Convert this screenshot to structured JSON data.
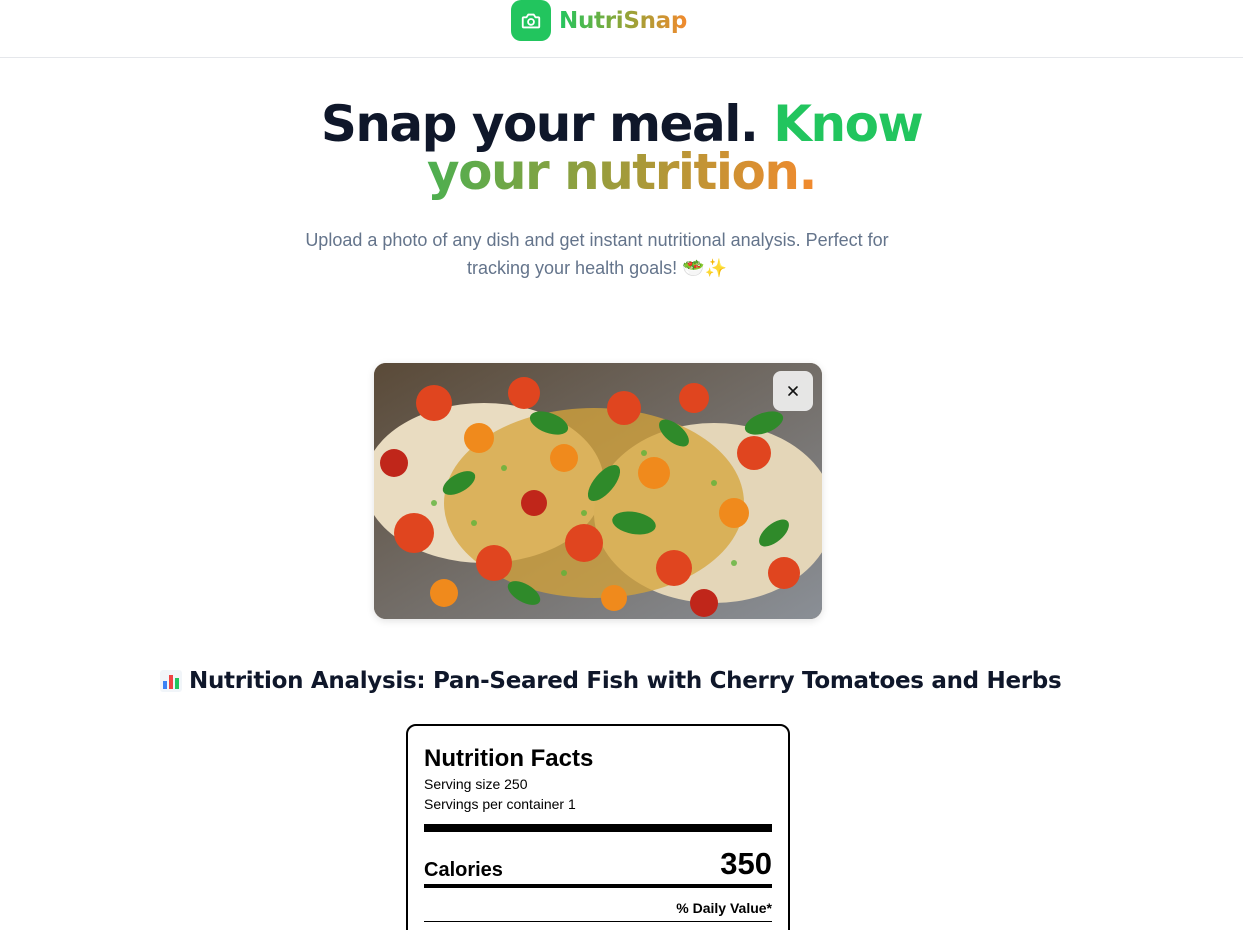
{
  "brand": {
    "name": "NutriSnap",
    "icon": "camera-icon",
    "color": "#22c55e"
  },
  "hero": {
    "line1_dark": "Snap your meal.",
    "line1_green": "Know",
    "line2": "your nutrition.",
    "subtitle": "Upload a photo of any dish and get instant nutritional analysis. Perfect for tracking your health goals! 🥗✨"
  },
  "upload": {
    "photo_alt": "Uploaded meal photo",
    "remove_icon": "close-icon"
  },
  "analysis": {
    "icon": "bar-chart-icon",
    "title": "Nutrition Analysis: Pan-Seared Fish with Cherry Tomatoes and Herbs"
  },
  "nutrition_facts": {
    "title": "Nutrition Facts",
    "serving_size": "Serving size 250",
    "servings_per_container": "Servings per container 1",
    "calories_label": "Calories",
    "calories_value": "350",
    "daily_value_header": "% Daily Value*"
  },
  "colors": {
    "accent_green": "#22c55e",
    "accent_orange": "#f28a2e",
    "text_dark": "#0f172a",
    "text_muted": "#64748b"
  }
}
